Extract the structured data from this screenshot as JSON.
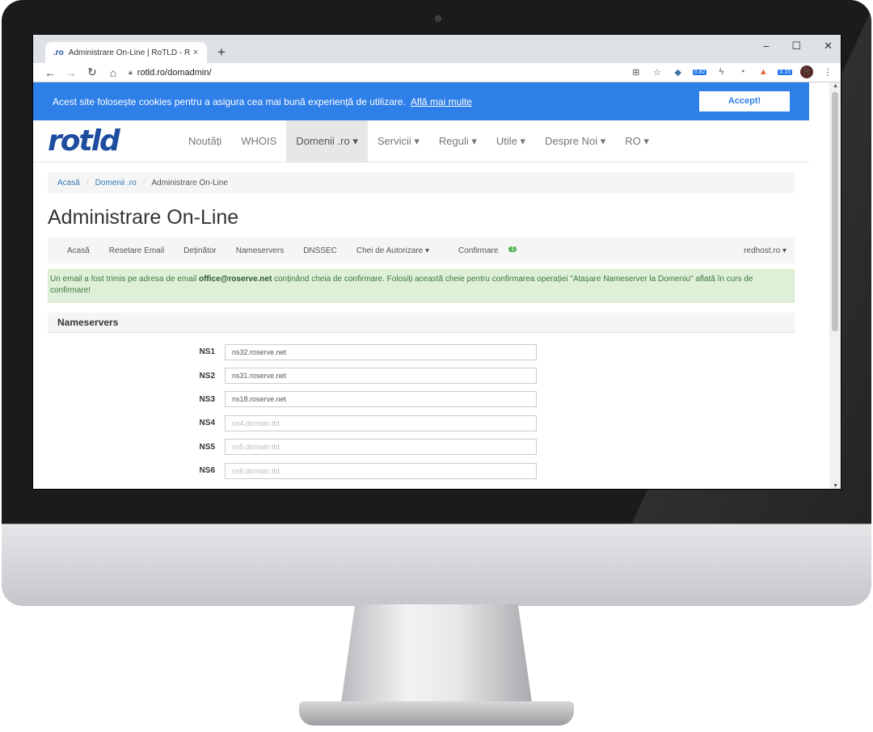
{
  "browser": {
    "tab_favicon": ".ro",
    "tab_title": "Administrare On-Line | RoTLD - R",
    "tab_close": "×",
    "new_tab": "+",
    "win_min": "–",
    "win_max": "☐",
    "win_close": "✕",
    "url": "rotld.ro/domadmin/",
    "ext_badge_1": "0.82",
    "ext_badge_2": "0.15",
    "avatar": "R"
  },
  "cookie": {
    "text": "Acest site folosește cookies pentru a asigura cea mai bună experiență de utilizare.",
    "link": "Află mai multe",
    "accept": "Accept!"
  },
  "navbar": {
    "logo": "rotld",
    "items": [
      {
        "label": "Noutăți"
      },
      {
        "label": "WHOIS"
      },
      {
        "label": "Domenii .ro ▾"
      },
      {
        "label": "Servicii ▾"
      },
      {
        "label": "Reguli ▾"
      },
      {
        "label": "Utile ▾"
      },
      {
        "label": "Despre Noi ▾"
      },
      {
        "label": "RO ▾"
      }
    ]
  },
  "breadcrumb": {
    "home": "Acasă",
    "section": "Domenii .ro",
    "current": "Administrare On-Line",
    "sep": "/"
  },
  "page_title": "Administrare On-Line",
  "subnav": {
    "items": [
      "Acasă",
      "Resetare Email",
      "Deținător",
      "Nameservers",
      "DNSSEC",
      "Chei de Autorizare ▾"
    ],
    "confirm_label": "Confirmare",
    "confirm_count": "1",
    "account": "redhost.ro ▾"
  },
  "alert": {
    "pre": "Un email a fost trimis pe adresa de email ",
    "email": "office@roserve.net",
    "post": " conținând cheia de confirmare. Folosiți această cheie pentru confirmarea operației \"Atașare Nameserver la Domeniu\" aflată în curs de confirmare!"
  },
  "nameservers": {
    "heading": "Nameservers",
    "rows": [
      {
        "label": "NS1",
        "value": "ns32.roserve.net",
        "placeholder": ""
      },
      {
        "label": "NS2",
        "value": "ns31.roserve.net",
        "placeholder": ""
      },
      {
        "label": "NS3",
        "value": "ns18.roserve.net",
        "placeholder": ""
      },
      {
        "label": "NS4",
        "value": "",
        "placeholder": "ns4.domain.tld"
      },
      {
        "label": "NS5",
        "value": "",
        "placeholder": "ns5.domain.tld"
      },
      {
        "label": "NS6",
        "value": "",
        "placeholder": "ns6.domain.tld"
      }
    ]
  }
}
